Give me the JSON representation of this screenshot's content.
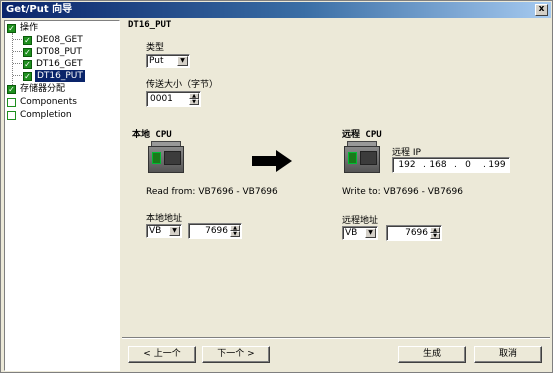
{
  "window": {
    "title": "Get/Put 向导",
    "close_glyph": "x"
  },
  "tree": {
    "check_glyph": "✓",
    "items": [
      {
        "label": "操作",
        "checked": true
      },
      {
        "label": "DE08_GET",
        "checked": true
      },
      {
        "label": "DT08_PUT",
        "checked": true
      },
      {
        "label": "DT16_GET",
        "checked": true
      },
      {
        "label": "DT16_PUT",
        "checked": true,
        "selected": true
      },
      {
        "label": "存储器分配",
        "checked": true
      },
      {
        "label": "Components",
        "checked": false
      },
      {
        "label": "Completion",
        "checked": false
      }
    ]
  },
  "main": {
    "heading": "DT16_PUT",
    "type_label": "类型",
    "type_value": "Put",
    "size_label": "传送大小（字节）",
    "size_value": "0001",
    "local": {
      "heading": "本地 CPU",
      "read_from": "Read from: VB7696 - VB7696",
      "address_label": "本地地址",
      "area_value": "VB",
      "address_value": "7696"
    },
    "remote": {
      "heading": "远程 CPU",
      "ip_label": "远程 IP",
      "ip": [
        "192",
        "168",
        "0",
        "199"
      ],
      "write_to": "Write to: VB7696 - VB7696",
      "address_label": "远程地址",
      "area_value": "VB",
      "address_value": "7696"
    }
  },
  "buttons": {
    "prev": "< 上一个",
    "next": "下一个 >",
    "finish": "生成",
    "cancel": "取消"
  },
  "glyphs": {
    "dropdown": "▼",
    "up": "▲",
    "down": "▼"
  }
}
